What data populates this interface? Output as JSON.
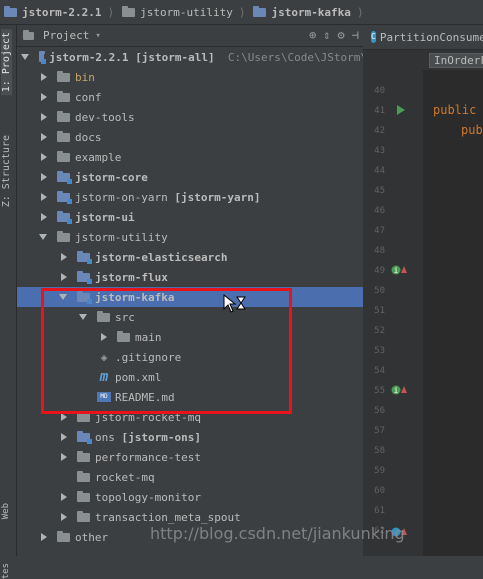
{
  "nav": {
    "crumbs": [
      "jstorm-2.2.1",
      "jstorm-utility",
      "jstorm-kafka"
    ]
  },
  "sidebar": {
    "tabs": [
      "1: Project",
      "Z: Structure",
      "Web",
      "tes"
    ]
  },
  "panel": {
    "title": "Project",
    "tools": [
      "⊕",
      "⇕",
      "⚙",
      "⊣"
    ]
  },
  "tree": [
    {
      "label": "jstorm-2.2.1",
      "suffix": "[jstorm-all]",
      "path": "C:\\Users\\Code\\JStorm\\"
    },
    {
      "label": "bin"
    },
    {
      "label": "conf"
    },
    {
      "label": "dev-tools"
    },
    {
      "label": "docs"
    },
    {
      "label": "example"
    },
    {
      "label": "jstorm-core"
    },
    {
      "label": "jstorm-on-yarn",
      "suffix": "[jstorm-yarn]"
    },
    {
      "label": "jstorm-ui"
    },
    {
      "label": "jstorm-utility"
    },
    {
      "label": "jstorm-elasticsearch"
    },
    {
      "label": "jstorm-flux"
    },
    {
      "label": "jstorm-kafka"
    },
    {
      "label": "src"
    },
    {
      "label": "main"
    },
    {
      "label": ".gitignore"
    },
    {
      "label": "pom.xml"
    },
    {
      "label": "README.md"
    },
    {
      "label": "jstorm-rocket-mq"
    },
    {
      "label": "ons",
      "suffix": "[jstorm-ons]"
    },
    {
      "label": "performance-test"
    },
    {
      "label": "rocket-mq"
    },
    {
      "label": "topology-monitor"
    },
    {
      "label": "transaction_meta_spout"
    },
    {
      "label": "other"
    }
  ],
  "icons": {
    "md": "MD"
  },
  "editor": {
    "tab": "PartitionConsume",
    "breadcrumb": "InOrderF",
    "line_numbers": [
      "40",
      "41",
      "42",
      "43",
      "44",
      "45",
      "46",
      "47",
      "48",
      "49",
      "50",
      "51",
      "52",
      "53",
      "54",
      "55",
      "56",
      "57",
      "58",
      "59",
      "60",
      "61",
      "62"
    ],
    "code": [
      "public",
      "publ"
    ]
  },
  "watermark": "http://blog.csdn.net/jiankunking"
}
